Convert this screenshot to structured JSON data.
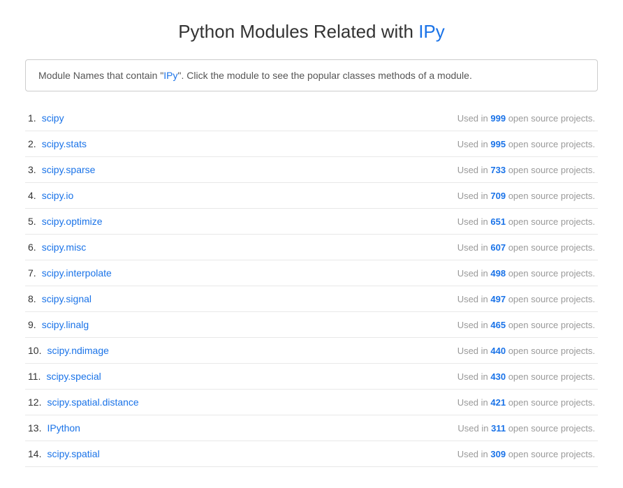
{
  "page": {
    "title_prefix": "Python Modules Related with ",
    "title_highlight": "IPy",
    "info_box": {
      "text_before": "Module Names that contain \"",
      "highlight": "IPy",
      "text_after": "\". Click the module to see the popular classes methods of a module."
    },
    "modules": [
      {
        "number": "1.",
        "name": "scipy",
        "count": "999"
      },
      {
        "number": "2.",
        "name": "scipy.stats",
        "count": "995"
      },
      {
        "number": "3.",
        "name": "scipy.sparse",
        "count": "733"
      },
      {
        "number": "4.",
        "name": "scipy.io",
        "count": "709"
      },
      {
        "number": "5.",
        "name": "scipy.optimize",
        "count": "651"
      },
      {
        "number": "6.",
        "name": "scipy.misc",
        "count": "607"
      },
      {
        "number": "7.",
        "name": "scipy.interpolate",
        "count": "498"
      },
      {
        "number": "8.",
        "name": "scipy.signal",
        "count": "497"
      },
      {
        "number": "9.",
        "name": "scipy.linalg",
        "count": "465"
      },
      {
        "number": "10.",
        "name": "scipy.ndimage",
        "count": "440"
      },
      {
        "number": "11.",
        "name": "scipy.special",
        "count": "430"
      },
      {
        "number": "12.",
        "name": "scipy.spatial.distance",
        "count": "421"
      },
      {
        "number": "13.",
        "name": "IPython",
        "count": "311"
      },
      {
        "number": "14.",
        "name": "scipy.spatial",
        "count": "309"
      }
    ],
    "usage_label_before": "Used in ",
    "usage_label_after": " open source projects."
  }
}
